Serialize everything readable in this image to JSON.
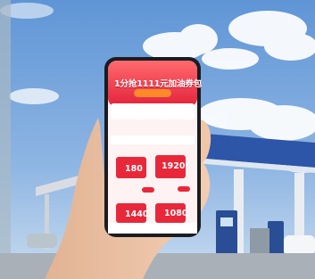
{
  "phone_screen": {
    "headline": "1分抢1111元加油券包",
    "coupons": [
      {
        "amount": "180"
      },
      {
        "amount": "1920"
      },
      {
        "amount": "1440"
      },
      {
        "amount": "1080"
      }
    ]
  },
  "colors": {
    "sky": "#6f9fd8",
    "canopy_blue": "#2d56a8",
    "promo_red": "#e8283a",
    "promo_pink": "#f7c3cc"
  }
}
